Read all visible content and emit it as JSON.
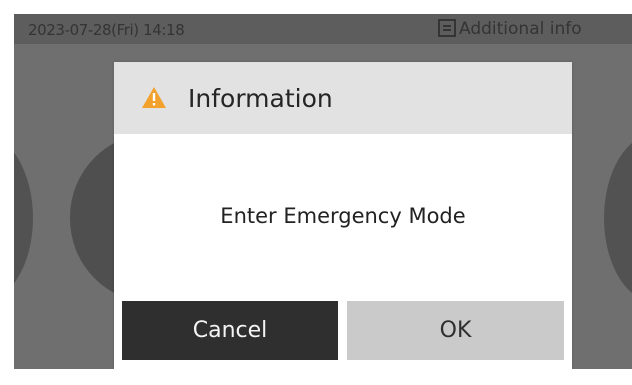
{
  "status_bar": {
    "datetime": "2023-07-28(Fri) 14:18",
    "additional_info_label": "Additional info",
    "info_icon": "document-info-icon"
  },
  "dialog": {
    "warning_icon": "warning-triangle-icon",
    "title": "Information",
    "message": "Enter Emergency Mode",
    "buttons": {
      "cancel_label": "Cancel",
      "ok_label": "OK"
    }
  },
  "colors": {
    "warning_icon": "#f2a12c",
    "dialog_header": "#e2e2e2",
    "cancel_button": "#2f2f2f",
    "ok_button": "#cacaca"
  }
}
